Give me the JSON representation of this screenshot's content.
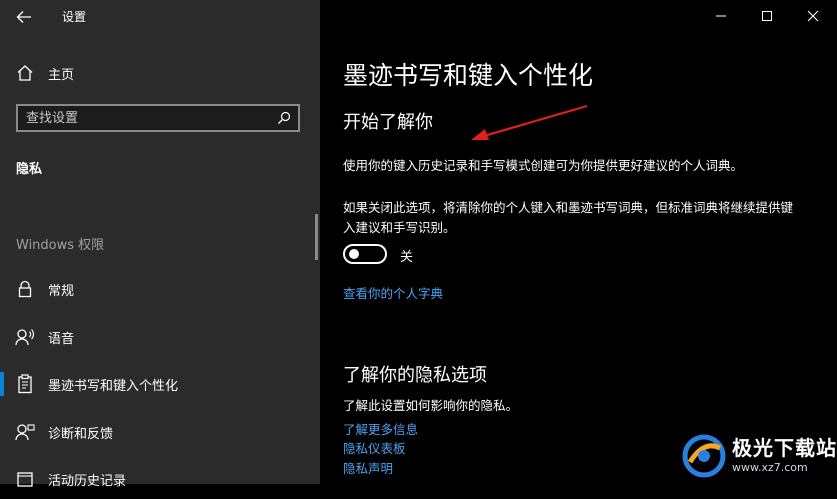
{
  "titlebar": {
    "app_title": "设置",
    "icons": {
      "back": "back-arrow-icon",
      "minimize": "minimize-icon",
      "maximize": "maximize-icon",
      "close": "close-icon"
    }
  },
  "sidebar": {
    "home_label": "主页",
    "search_placeholder": "查找设置",
    "privacy_header": "隐私",
    "windows_permissions_header": "Windows 权限",
    "items": [
      {
        "label": "常规",
        "icon": "lock-icon"
      },
      {
        "label": "语音",
        "icon": "speech-icon"
      },
      {
        "label": "墨迹书写和键入个性化",
        "icon": "clipboard-pen-icon",
        "selected": true
      },
      {
        "label": "诊断和反馈",
        "icon": "feedback-person-icon"
      },
      {
        "label": "活动历史记录",
        "icon": "history-icon"
      }
    ]
  },
  "main": {
    "page_title": "墨迹书写和键入个性化",
    "section1": {
      "title": "开始了解你",
      "description": "使用你的键入历史记录和手写模式创建可为你提供更好建议的个人词典。",
      "note": "如果关闭此选项，将清除你的个人键入和墨迹书写词典，但标准词典将继续提供键入建议和手写识别。",
      "toggle_state": "关",
      "toggle_on": false,
      "dictionary_link": "查看你的个人字典"
    },
    "section2": {
      "title": "了解你的隐私选项",
      "description": "了解此设置如何影响你的隐私。",
      "links": [
        "了解更多信息",
        "隐私仪表板",
        "隐私声明"
      ]
    }
  },
  "watermark": {
    "brand": "极光下载站",
    "url": "www.xz7.com"
  },
  "colors": {
    "sidebar_bg": "#2b2b2b",
    "main_bg": "#000000",
    "accent": "#0a84d8",
    "link": "#4aa2f0",
    "annotation_arrow": "#e0201a"
  }
}
